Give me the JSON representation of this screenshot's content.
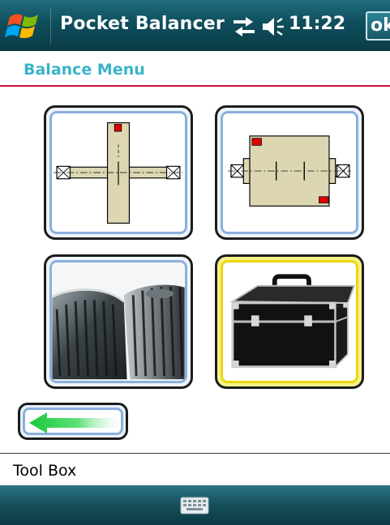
{
  "titlebar": {
    "app_title": "Pocket Balancer",
    "time": "11:22",
    "ok_label": "ok",
    "icons": [
      "windows-start-icon",
      "connectivity-icon",
      "volume-icon"
    ]
  },
  "header": {
    "title": "Balance Menu",
    "accent_color": "#3ab3c8",
    "rule_color": "#c8102e"
  },
  "tiles": [
    {
      "name": "single-plane-balance",
      "icon": "single-plane-rotor-icon",
      "selected": false
    },
    {
      "name": "two-plane-balance",
      "icon": "two-plane-rotor-icon",
      "selected": false
    },
    {
      "name": "gears",
      "icon": "gears-icon",
      "selected": false
    },
    {
      "name": "tool-box",
      "icon": "toolbox-icon",
      "selected": true
    }
  ],
  "back_button": {
    "icon": "green-left-arrow-icon"
  },
  "status": {
    "text": "Tool Box"
  },
  "bottombar": {
    "icon": "keyboard-icon"
  }
}
